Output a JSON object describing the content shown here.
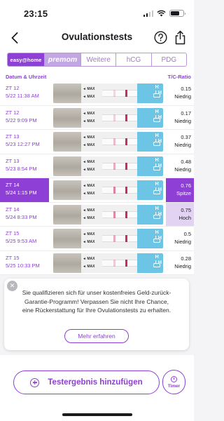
{
  "status_bar": {
    "time": "23:15",
    "signal_bars": 4,
    "signal_active": 2,
    "battery_level": 0.7
  },
  "nav": {
    "title": "Ovulationstests"
  },
  "tabs": [
    {
      "label": "easy@home",
      "active": true
    },
    {
      "label": "premom"
    },
    {
      "label": "Weitere"
    },
    {
      "label": "hCG"
    },
    {
      "label": "PDG"
    }
  ],
  "table": {
    "col_date": "Datum & Uhrzeit",
    "col_ratio": "T/C-Ratio",
    "rows": [
      {
        "zt": "ZT 12",
        "datetime": "5/22 11:38 AM",
        "ratio": "0.15",
        "level": "Niedrig",
        "t_line": 0.25
      },
      {
        "zt": "ZT 12",
        "datetime": "5/22 9:09 PM",
        "ratio": "0.17",
        "level": "Niedrig",
        "t_line": 0.3
      },
      {
        "zt": "ZT 13",
        "datetime": "5/23 12:27 PM",
        "ratio": "0.37",
        "level": "Niedrig",
        "t_line": 0.45
      },
      {
        "zt": "ZT 13",
        "datetime": "5/23 8:54 PM",
        "ratio": "0.48",
        "level": "Niedrig",
        "t_line": 0.55
      },
      {
        "zt": "ZT 14",
        "datetime": "5/24 1:15 PM",
        "ratio": "0.76",
        "level": "Spitze",
        "t_line": 0.85,
        "highlight": "strong"
      },
      {
        "zt": "ZT 14",
        "datetime": "5/24 8:33 PM",
        "ratio": "0.75",
        "level": "Hoch",
        "t_line": 0.8,
        "highlight": "soft"
      },
      {
        "zt": "ZT 15",
        "datetime": "5/25 9:53 AM",
        "ratio": "0.5",
        "level": "Niedrig",
        "t_line": 0.55
      },
      {
        "zt": "ZT 15",
        "datetime": "5/25 10:33 PM",
        "ratio": "0.28",
        "level": "Niedrig",
        "t_line": 0.35
      }
    ]
  },
  "banner": {
    "text": "Sie qualifizieren sich für unser kostenfreies Geld-zurück-Garantie-Programm! Verpassen Sie nicht Ihre Chance, eine Rückerstattung für Ihre Ovulationstests zu erhalten.",
    "button": "Mehr erfahren"
  },
  "bottom": {
    "add_label": "Testergebnis hinzufügen",
    "timer_label": "Timer"
  },
  "colors": {
    "accent": "#8d3fd6",
    "accent_soft": "#e2d3f2",
    "test_line": "#c52f5a"
  }
}
